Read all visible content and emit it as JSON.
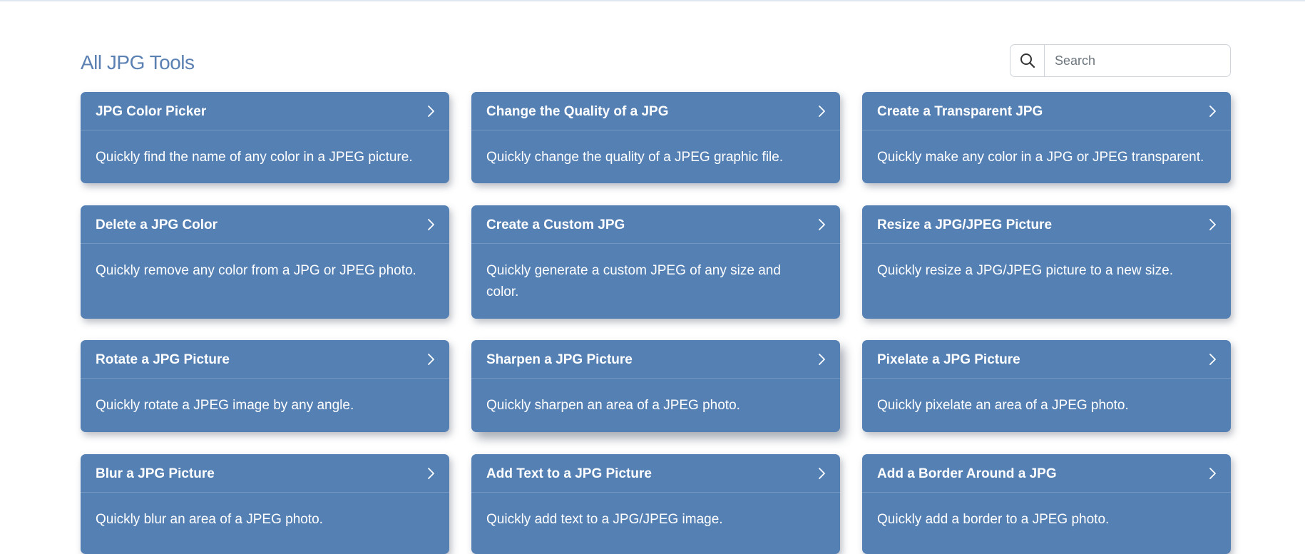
{
  "page": {
    "title": "All JPG Tools"
  },
  "search": {
    "placeholder": "Search",
    "value": "",
    "icon": "search-icon"
  },
  "colors": {
    "accent": "#5580b4",
    "title": "#5b80b2"
  },
  "tools": [
    {
      "title": "JPG Color Picker",
      "description": "Quickly find the name of any color in a JPEG picture."
    },
    {
      "title": "Change the Quality of a JPG",
      "description": "Quickly change the quality of a JPEG graphic file."
    },
    {
      "title": "Create a Transparent JPG",
      "description": "Quickly make any color in a JPG or JPEG transparent."
    },
    {
      "title": "Delete a JPG Color",
      "description": "Quickly remove any color from a JPG or JPEG photo."
    },
    {
      "title": "Create a Custom JPG",
      "description": "Quickly generate a custom JPEG of any size and color."
    },
    {
      "title": "Resize a JPG/JPEG Picture",
      "description": "Quickly resize a JPG/JPEG picture to a new size."
    },
    {
      "title": "Rotate a JPG Picture",
      "description": "Quickly rotate a JPEG image by any angle."
    },
    {
      "title": "Sharpen a JPG Picture",
      "description": "Quickly sharpen an area of a JPEG photo."
    },
    {
      "title": "Pixelate a JPG Picture",
      "description": "Quickly pixelate an area of a JPEG photo."
    },
    {
      "title": "Blur a JPG Picture",
      "description": "Quickly blur an area of a JPEG photo."
    },
    {
      "title": "Add Text to a JPG Picture",
      "description": "Quickly add text to a JPG/JPEG image."
    },
    {
      "title": "Add a Border Around a JPG",
      "description": "Quickly add a border to a JPEG photo."
    }
  ]
}
